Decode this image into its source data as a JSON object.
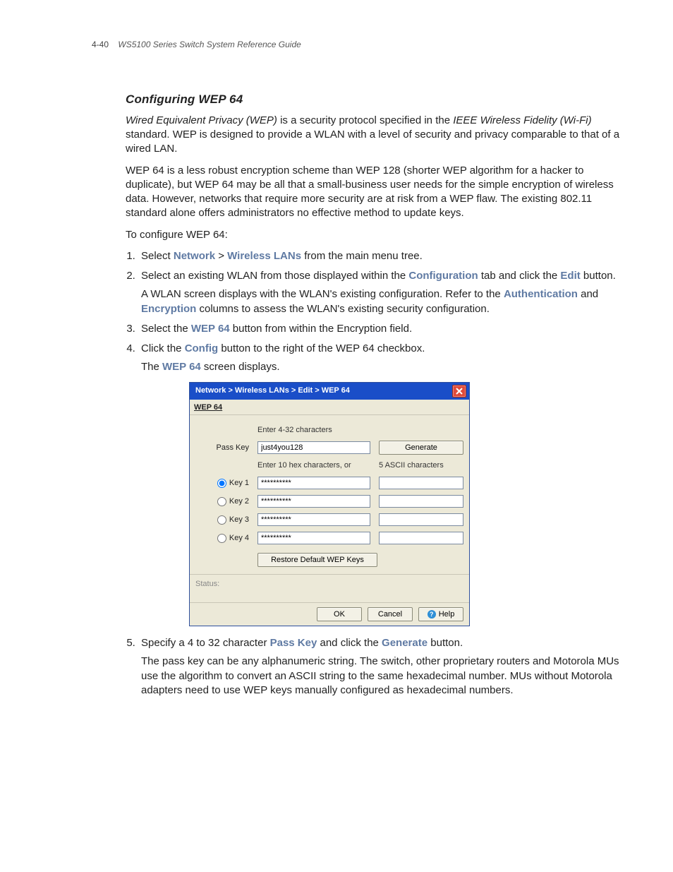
{
  "header": {
    "page_number": "4-40",
    "doc_title": "WS5100 Series Switch System Reference Guide"
  },
  "section": {
    "title": "Configuring WEP 64",
    "intro1_a": "Wired Equivalent Privacy (WEP)",
    "intro1_b": " is a security protocol specified in the ",
    "intro1_c": "IEEE Wireless Fidelity (Wi-Fi)",
    "intro1_d": " standard. WEP is designed to provide a WLAN with a level of security and privacy comparable to that of a wired LAN.",
    "intro2": "WEP 64 is a less robust encryption scheme than WEP 128 (shorter WEP algorithm for a hacker to duplicate), but WEP 64 may be all that a small-business user needs for the simple encryption of wireless data. However, networks that require more security are at risk from a WEP flaw. The existing 802.11 standard alone offers administrators no effective method to update keys.",
    "lead": "To configure WEP 64:"
  },
  "steps": {
    "s1_a": "Select ",
    "s1_net": "Network",
    "s1_gt": " > ",
    "s1_wlan": "Wireless LANs",
    "s1_b": " from the main menu tree.",
    "s2_a": "Select an existing WLAN from those displayed within the ",
    "s2_conf": "Configuration",
    "s2_b": " tab and click the ",
    "s2_edit": "Edit",
    "s2_c": " button.",
    "s2_body_a": "A WLAN screen displays with the WLAN's existing configuration. Refer to the ",
    "s2_auth": "Authentication",
    "s2_body_b": " and ",
    "s2_enc": "Encryption",
    "s2_body_c": " columns to assess the WLAN's existing security configuration.",
    "s3_a": "Select the ",
    "s3_wep": "WEP 64",
    "s3_b": " button from within the Encryption field.",
    "s4_a": "Click the ",
    "s4_cfg": "Config",
    "s4_b": " button to the right of the WEP 64 checkbox.",
    "s4_body_a": "The ",
    "s4_body_wep": "WEP 64",
    "s4_body_b": " screen displays.",
    "s5_a": "Specify a 4 to 32 character ",
    "s5_pk": "Pass Key",
    "s5_b": " and click the ",
    "s5_gen": "Generate",
    "s5_c": " button.",
    "s5_body": "The pass key can be any alphanumeric string. The switch, other proprietary routers and Motorola MUs use the algorithm to convert an ASCII string to the same hexadecimal number. MUs without Motorola adapters need to use WEP keys manually configured as hexadecimal numbers."
  },
  "dialog": {
    "title": "Network > Wireless LANs > Edit > WEP 64",
    "caption": "WEP 64",
    "hint_pass": "Enter 4-32 characters",
    "pass_label": "Pass Key",
    "pass_value": "just4you128",
    "generate": "Generate",
    "hint_hex": "Enter 10 hex characters, or",
    "hint_ascii": "5 ASCII characters",
    "keys": [
      {
        "label": "Key 1",
        "hex": "**********",
        "ascii": "",
        "selected": true
      },
      {
        "label": "Key 2",
        "hex": "**********",
        "ascii": "",
        "selected": false
      },
      {
        "label": "Key 3",
        "hex": "**********",
        "ascii": "",
        "selected": false
      },
      {
        "label": "Key 4",
        "hex": "**********",
        "ascii": "",
        "selected": false
      }
    ],
    "restore": "Restore Default WEP Keys",
    "status_label": "Status:",
    "ok": "OK",
    "cancel": "Cancel",
    "help": "Help"
  }
}
